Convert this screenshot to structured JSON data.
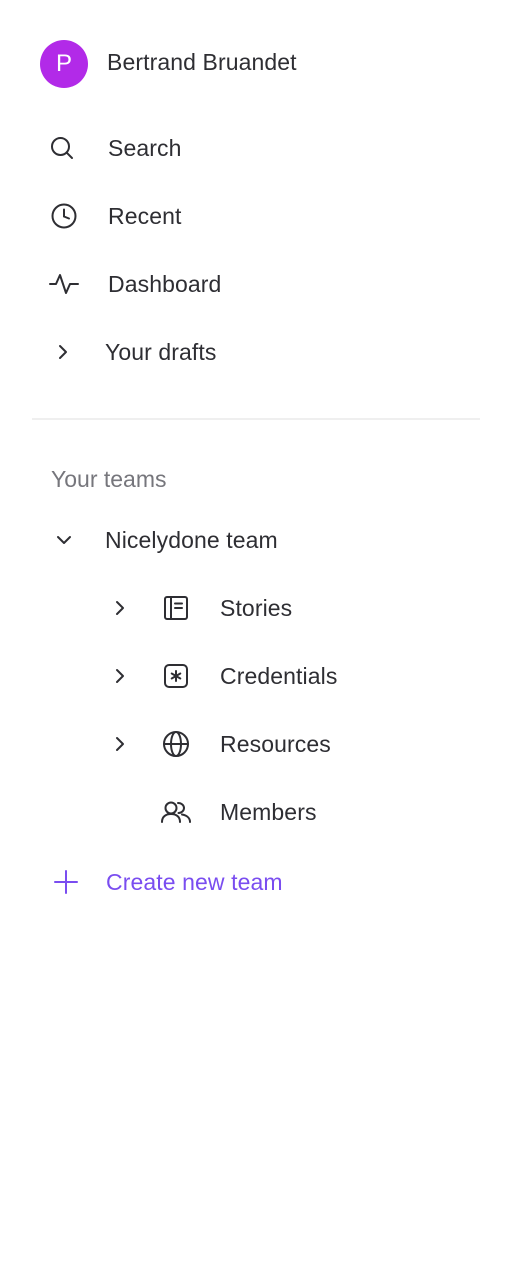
{
  "profile": {
    "avatar_initial": "P",
    "name": "Bertrand Bruandet",
    "avatar_color": "#b22ae8"
  },
  "nav": {
    "search": {
      "label": "Search",
      "icon": "search-icon"
    },
    "recent": {
      "label": "Recent",
      "icon": "clock-icon"
    },
    "dashboard": {
      "label": "Dashboard",
      "icon": "activity-icon"
    },
    "drafts": {
      "label": "Your drafts",
      "icon": "chevron-right-icon"
    }
  },
  "teams": {
    "section_title": "Your teams",
    "team": {
      "name": "Nicelydone team",
      "icon": "chevron-down-icon",
      "items": [
        {
          "label": "Stories",
          "icon": "document-icon",
          "expandable": true
        },
        {
          "label": "Credentials",
          "icon": "asterisk-square-icon",
          "expandable": true
        },
        {
          "label": "Resources",
          "icon": "globe-icon",
          "expandable": true
        },
        {
          "label": "Members",
          "icon": "users-icon",
          "expandable": false
        }
      ]
    },
    "create_label": "Create new team",
    "accent_color": "#7a4df0"
  }
}
